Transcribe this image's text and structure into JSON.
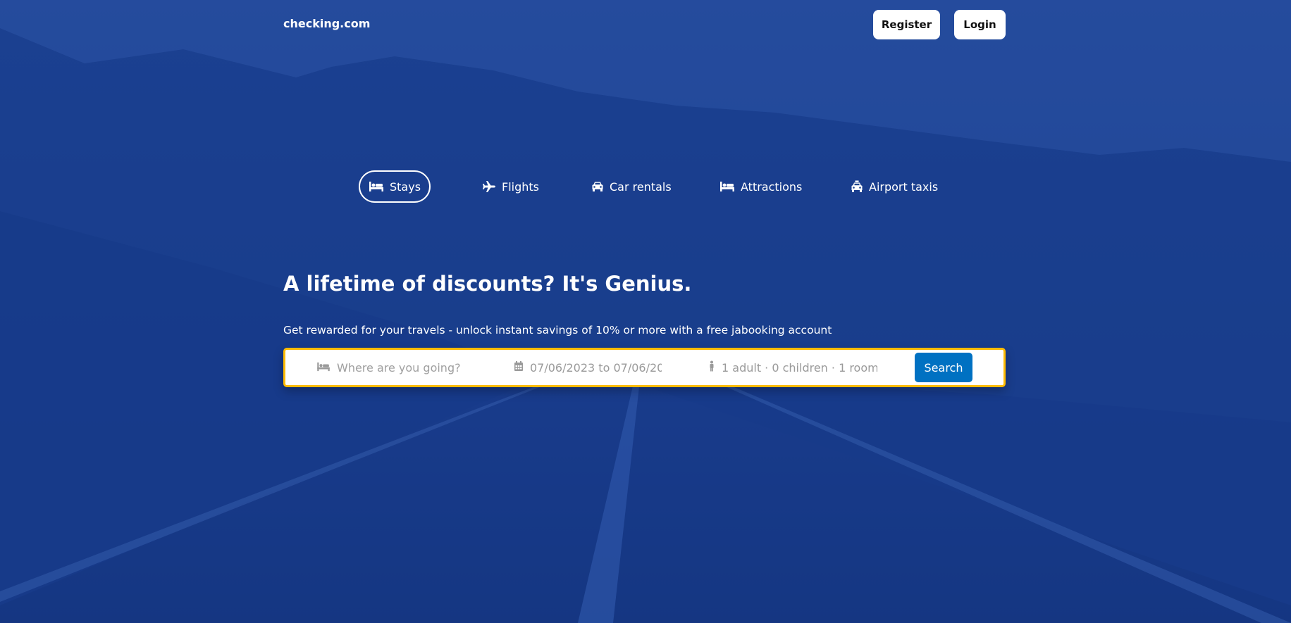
{
  "header": {
    "logo": "checking.com",
    "register_label": "Register",
    "login_label": "Login"
  },
  "nav": {
    "items": [
      {
        "label": "Stays",
        "icon": "bed-icon",
        "active": true
      },
      {
        "label": "Flights",
        "icon": "plane-icon",
        "active": false
      },
      {
        "label": "Car rentals",
        "icon": "car-icon",
        "active": false
      },
      {
        "label": "Attractions",
        "icon": "bed-icon",
        "active": false
      },
      {
        "label": "Airport taxis",
        "icon": "taxi-icon",
        "active": false
      }
    ]
  },
  "hero": {
    "title": "A lifetime of discounts? It's Genius.",
    "subtitle": "Get rewarded for your travels - unlock instant savings of 10% or more with a free jabooking account"
  },
  "search": {
    "destination_placeholder": "Where are you going?",
    "dates": "07/06/2023 to 07/06/20",
    "guests": "1 adult · 0 children · 1 room",
    "button_label": "Search"
  },
  "colors": {
    "background_tint": "#1a3d84",
    "search_border": "#febb02",
    "search_button": "#0071c2"
  }
}
